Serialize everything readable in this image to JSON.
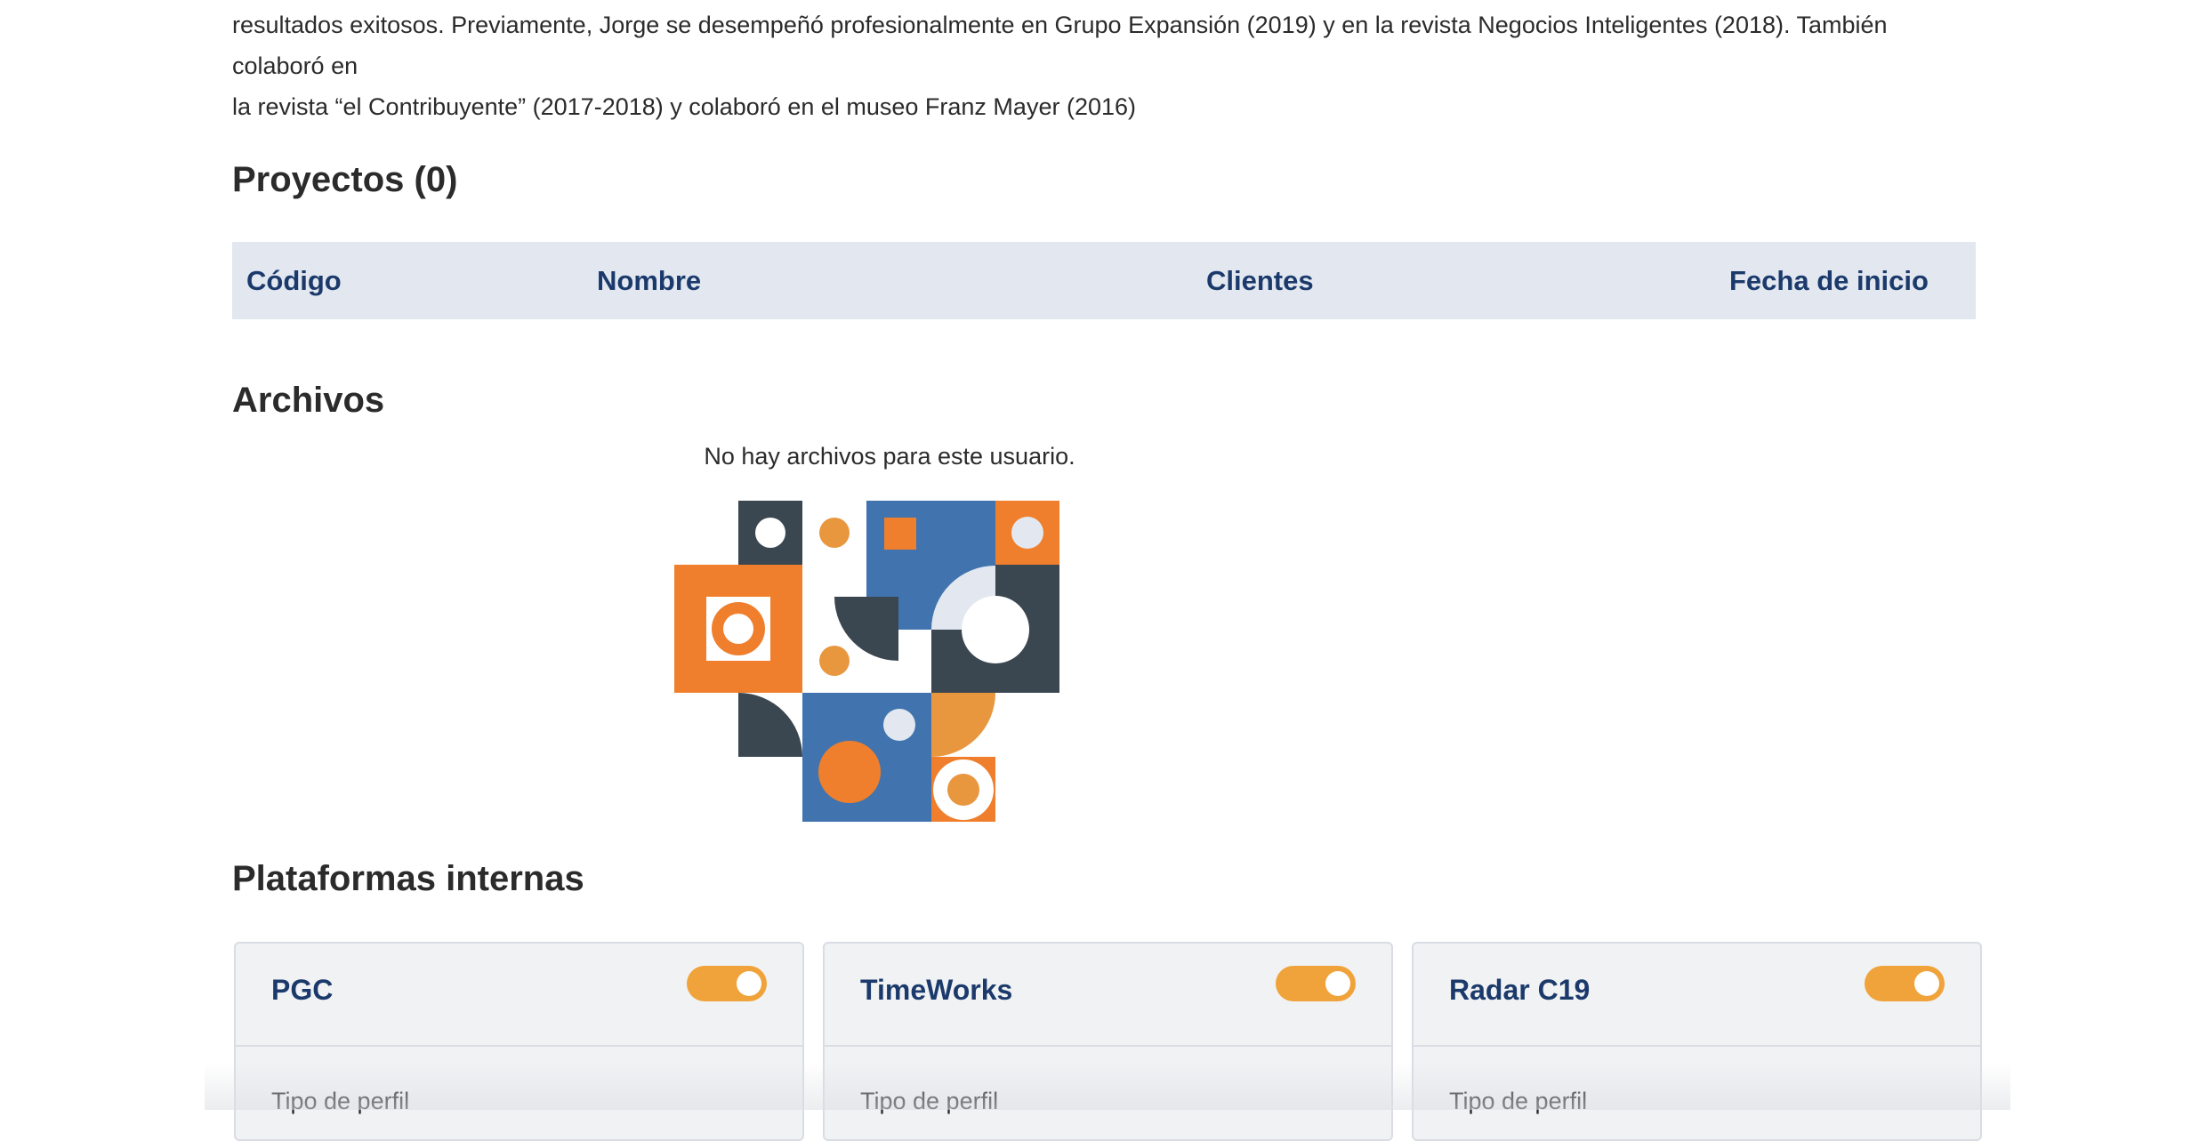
{
  "bio": {
    "line1": "resultados exitosos. Previamente, Jorge se desempeñó profesionalmente en Grupo Expansión (2019) y en la revista Negocios Inteligentes (2018). También colaboró en",
    "line2": "la revista “el Contribuyente” (2017-2018) y colaboró en el museo Franz Mayer (2016)"
  },
  "projects": {
    "title": "Proyectos (0)",
    "columns": [
      "Código",
      "Nombre",
      "Clientes",
      "Fecha de inicio"
    ],
    "rows": []
  },
  "files": {
    "title": "Archivos",
    "empty_message": "No hay archivos para este usuario.",
    "illustration": "geometric-empty-state-illustration"
  },
  "platforms": {
    "title": "Plataformas internas",
    "cards": [
      {
        "name": "PGC",
        "enabled": true,
        "field_label": "Tipo de perfil"
      },
      {
        "name": "TimeWorks",
        "enabled": true,
        "field_label": "Tipo de perfil"
      },
      {
        "name": "Radar C19",
        "enabled": true,
        "field_label": "Tipo de perfil"
      }
    ]
  },
  "colors": {
    "accent_orange": "#ef7f2d",
    "light_orange": "#e8973f",
    "blue": "#4174ae",
    "dark_slate": "#3a4650",
    "toggle_on": "#f0a33a",
    "heading_blue": "#1b3a6b",
    "table_header_bg": "#e2e7f0"
  }
}
